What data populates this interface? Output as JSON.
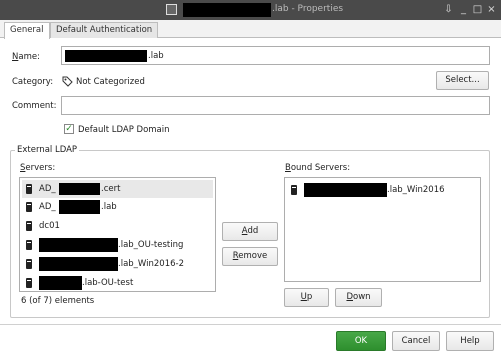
{
  "window": {
    "title_suffix": ".lab - Properties",
    "buttons": {
      "shade": "⇩",
      "minimize": "_",
      "maximize": "□",
      "close": "×"
    }
  },
  "tabs": [
    {
      "label": "General"
    },
    {
      "label": "Default Authentication"
    }
  ],
  "form": {
    "name_label_rest": "ame:",
    "name_value_suffix": ".lab",
    "category_label": "Category:",
    "category_value": "Not Categorized",
    "select_button": "Select...",
    "comment_label": "Comment:",
    "default_ldap_label": "Default LDAP Domain"
  },
  "external_ldap": {
    "legend": "External LDAP",
    "servers_label_rest": "ervers:",
    "bound_servers_label_rest": "ound Servers:",
    "servers": [
      {
        "prefix": "AD_",
        "suffix": ".cert"
      },
      {
        "prefix": "AD_",
        "suffix": ".lab"
      },
      {
        "prefix": "dc01",
        "suffix": ""
      },
      {
        "prefix": "",
        "suffix": ".lab_OU-testing"
      },
      {
        "prefix": "",
        "suffix": ".lab_Win2016-2"
      },
      {
        "prefix": "",
        "suffix": ".lab-OU-test"
      }
    ],
    "count_text": "6 (of 7) elements",
    "add_button": "Add",
    "remove_button": "Remove",
    "bound_servers": [
      {
        "suffix": ".lab_Win2016"
      }
    ],
    "up_button": "Up",
    "down_button": "Down"
  },
  "footer": {
    "ok": "OK",
    "cancel": "Cancel",
    "help": "Help"
  },
  "colors": {
    "titlebar": "#4a4a4a",
    "ok_button": "#2e8f2e"
  }
}
